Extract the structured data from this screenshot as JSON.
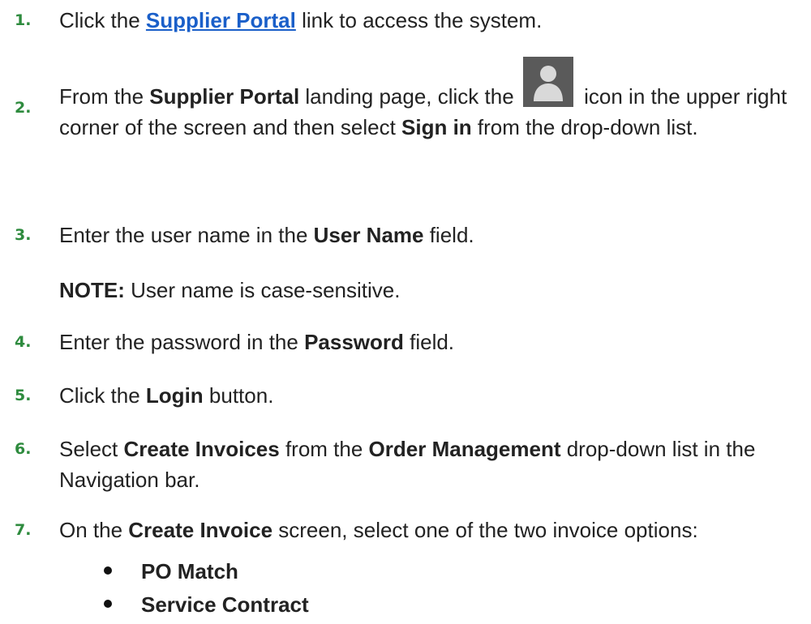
{
  "steps": [
    {
      "num": "1.",
      "pre": "Click the ",
      "link": "Supplier Portal",
      "post": " link to access the system."
    },
    {
      "num": "2.",
      "pre": "From the ",
      "b1": "Supplier Portal",
      "mid1": " landing page, click the ",
      "icon": "user-avatar-icon",
      "mid2": " icon in the upper right corner of the screen and then select ",
      "b2": "Sign in",
      "post": " from the drop-down list."
    },
    {
      "num": "3.",
      "pre": "Enter the user name in the ",
      "b1": "User Name",
      "post": " field."
    },
    {
      "num": "4.",
      "pre": "Enter the password in the ",
      "b1": "Password",
      "post": " field."
    },
    {
      "num": "5.",
      "pre": "Click the ",
      "b1": "Login",
      "post": " button."
    },
    {
      "num": "6.",
      "pre": "Select ",
      "b1": "Create Invoices",
      "mid1": " from the ",
      "b2": "Order Management",
      "post": " drop-down list in the Navigation bar."
    },
    {
      "num": "7.",
      "pre": "On the ",
      "b1": "Create Invoice",
      "post": " screen, select one of the two invoice options:"
    }
  ],
  "note": {
    "label": "NOTE:",
    "text": " User name is case-sensitive."
  },
  "options": [
    "PO Match",
    "Service Contract"
  ],
  "colors": {
    "step_number": "#2e8b3e",
    "link": "#1a5fc9",
    "icon_bg": "#5a5a5a"
  }
}
